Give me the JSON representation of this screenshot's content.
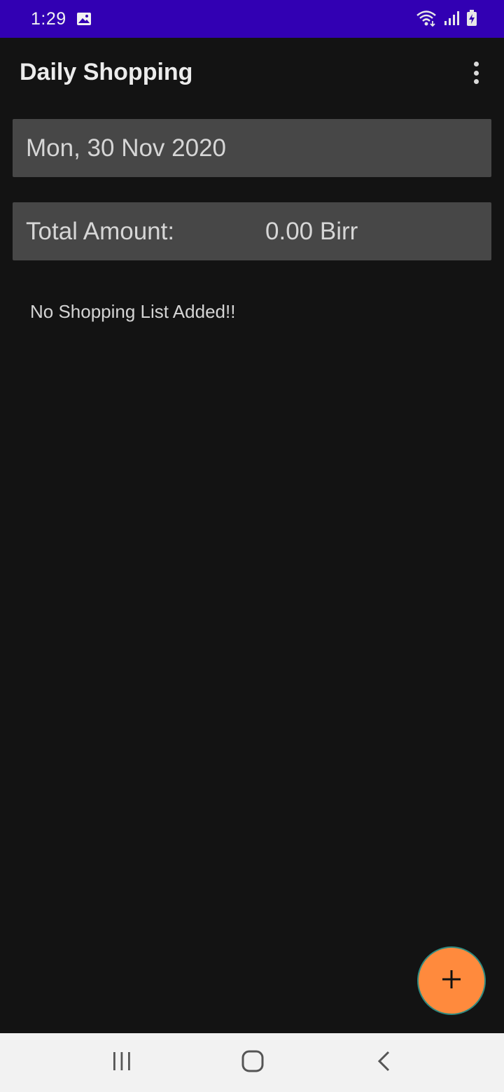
{
  "status_bar": {
    "time": "1:29",
    "icons": [
      "gallery-icon",
      "wifi-icon",
      "signal-icon",
      "battery-charging-icon"
    ],
    "background": "#3200b3"
  },
  "app_bar": {
    "title": "Daily Shopping",
    "menu_icon": "more-vert-icon"
  },
  "date_field": {
    "value": "Mon, 30 Nov 2020"
  },
  "total": {
    "label": "Total Amount:",
    "value": "0.00 Birr"
  },
  "empty_state": {
    "message": "No Shopping List Added!!"
  },
  "fab": {
    "icon": "plus-icon",
    "color": "#ff8a3d"
  },
  "nav_bar": {
    "buttons": [
      "recents-icon",
      "home-icon",
      "back-icon"
    ]
  },
  "colors": {
    "background": "#131313",
    "field": "#474747",
    "accent": "#ff8a3d"
  }
}
